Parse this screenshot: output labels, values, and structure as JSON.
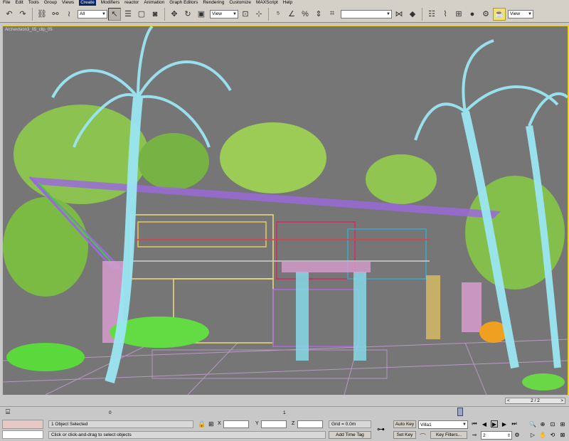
{
  "menu": {
    "items": [
      "File",
      "Edit",
      "Tools",
      "Group",
      "Views",
      "Create",
      "Modifiers",
      "reactor",
      "Animation",
      "Graph Editors",
      "Rendering",
      "Customize",
      "MAXScript",
      "Help"
    ],
    "active_index": 5
  },
  "toolbar": {
    "selection_filter": "All",
    "ref_coord_system": "View",
    "view_dropdown_right": "View",
    "named_selection_value": ""
  },
  "viewport": {
    "label": "Archevision3_05_clip_05",
    "background": "#767676",
    "active_border": "#e8d020"
  },
  "frame_counter": {
    "value": "2 / 2",
    "left_arrow": "<",
    "right_arrow": ">"
  },
  "trackbar": {
    "ticks": [
      "0",
      "1"
    ],
    "current_frame_fraction": 0.83
  },
  "status": {
    "selection_text": "1 Object Selected",
    "prompt_text": "Click or click-and-drag to select objects",
    "x_label": "X",
    "y_label": "Y",
    "z_label": "Z",
    "x_value": "",
    "y_value": "",
    "z_value": "",
    "grid": "Grid = 0.0m",
    "add_time_tag": "Add Time Tag",
    "auto_key": "Auto Key",
    "set_key": "Set Key",
    "key_filters": "Key Filters...",
    "selection_set": "Villa1",
    "current_frame": "2"
  }
}
